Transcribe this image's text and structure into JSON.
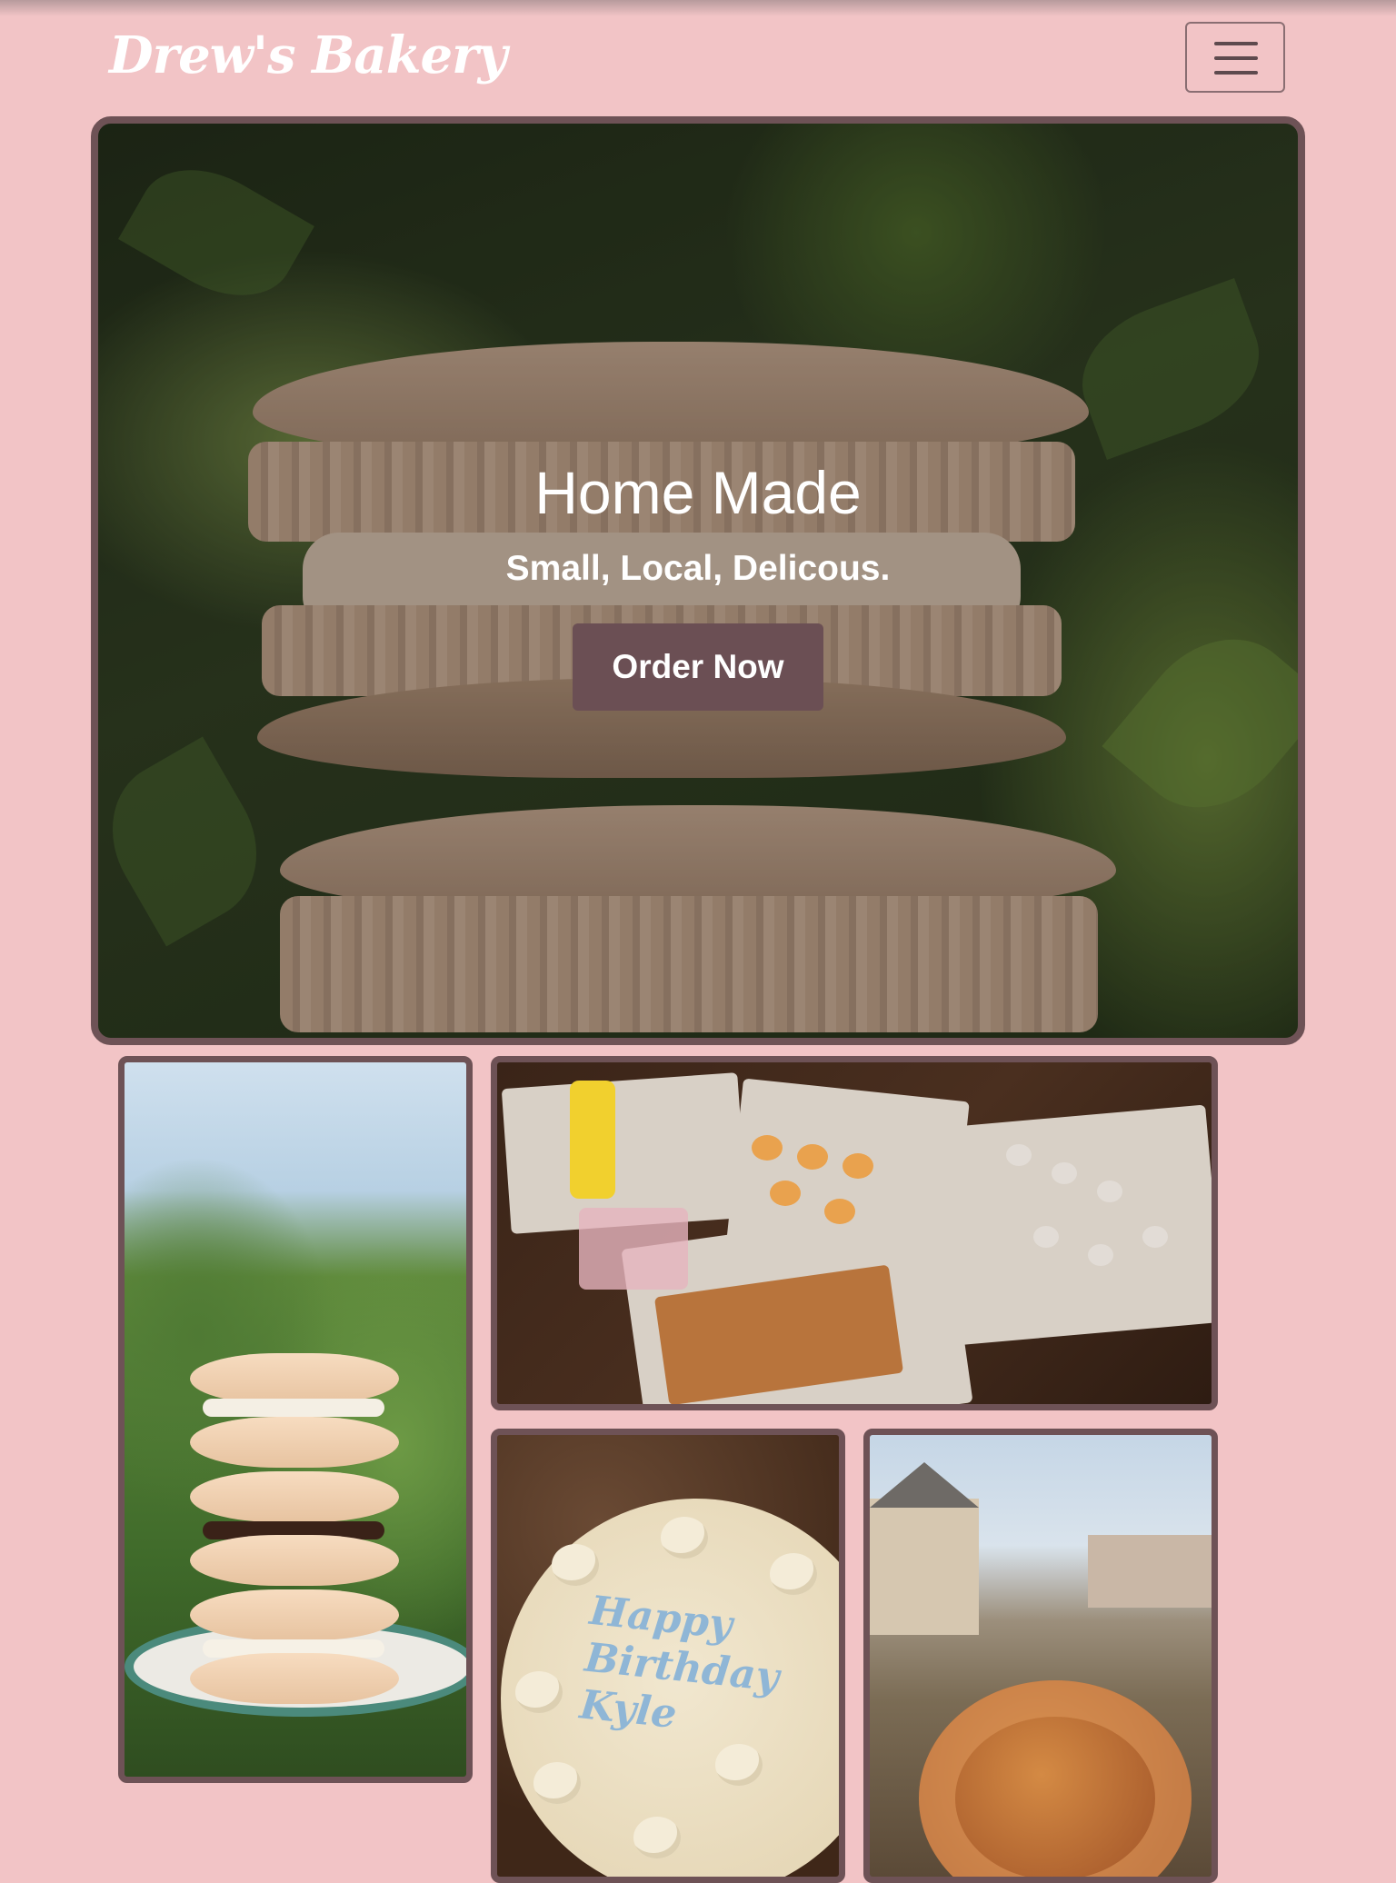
{
  "navbar": {
    "brand": "Drew's Bakery",
    "menu_icon": "hamburger-menu-icon"
  },
  "hero": {
    "title": "Home Made",
    "subtitle": "Small, Local, Delicous.",
    "button_label": "Order Now",
    "image_subject": "macaron-stack-photo"
  },
  "gallery": {
    "images": [
      {
        "subject": "macaron-tower-photo"
      },
      {
        "subject": "cookie-table-photo"
      },
      {
        "subject": "birthday-cake-photo"
      },
      {
        "subject": "sugar-donut-photo"
      }
    ],
    "cake_writing": "Happy Birthday Kyle"
  },
  "colors": {
    "background": "#f2c4c6",
    "accent": "#6b4f54",
    "border": "#6e5256",
    "text_light": "#ffffff"
  }
}
